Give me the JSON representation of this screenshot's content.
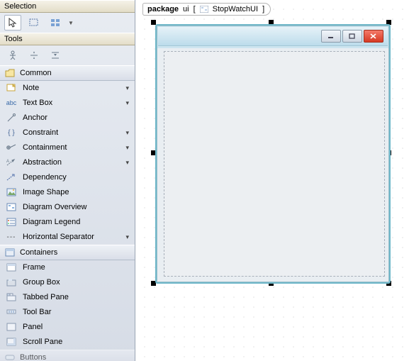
{
  "sections": {
    "selection_label": "Selection",
    "tools_label": "Tools"
  },
  "categories": {
    "common": "Common",
    "containers": "Containers",
    "buttons": "Buttons"
  },
  "common_items": [
    {
      "label": "Note",
      "arrow": true
    },
    {
      "label": "Text Box",
      "arrow": true
    },
    {
      "label": "Anchor",
      "arrow": false
    },
    {
      "label": "Constraint",
      "arrow": true
    },
    {
      "label": "Containment",
      "arrow": true
    },
    {
      "label": "Abstraction",
      "arrow": true
    },
    {
      "label": "Dependency",
      "arrow": false
    },
    {
      "label": "Image Shape",
      "arrow": false
    },
    {
      "label": "Diagram Overview",
      "arrow": false
    },
    {
      "label": "Diagram Legend",
      "arrow": false
    },
    {
      "label": "Horizontal Separator",
      "arrow": true
    }
  ],
  "container_items": [
    {
      "label": "Frame"
    },
    {
      "label": "Group Box"
    },
    {
      "label": "Tabbed Pane"
    },
    {
      "label": "Tool Bar"
    },
    {
      "label": "Panel"
    },
    {
      "label": "Scroll Pane"
    }
  ],
  "canvas": {
    "package_keyword": "package",
    "package_path": "ui",
    "package_element": "StopWatchUI"
  }
}
